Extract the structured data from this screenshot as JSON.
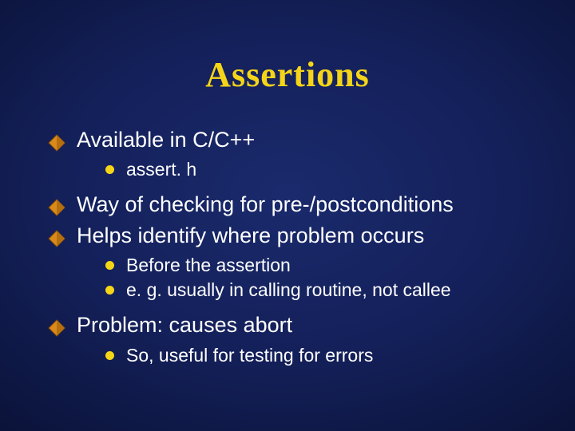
{
  "title": "Assertions",
  "bullets": [
    {
      "text": "Available in C/C++",
      "sub": [
        {
          "text": "assert. h"
        }
      ]
    },
    {
      "text": "Way of checking for pre-/postconditions",
      "sub": []
    },
    {
      "text": "Helps identify where problem occurs",
      "sub": [
        {
          "text": "Before the assertion"
        },
        {
          "text": "e. g. usually in calling routine, not callee"
        }
      ]
    },
    {
      "text": "Problem: causes abort",
      "sub": [
        {
          "text": "So, useful for testing for errors"
        }
      ]
    }
  ]
}
